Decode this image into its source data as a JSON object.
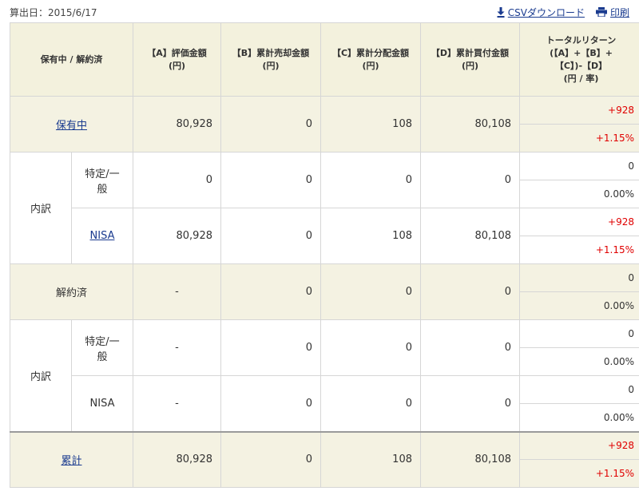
{
  "calc_date": "算出日：2015/6/17",
  "actions": {
    "csv": "CSVダウンロード",
    "print": "印刷"
  },
  "headers": {
    "status": "保有中 / 解約済",
    "a": "【A】評価金額\n(円)",
    "b": "【B】累計売却金額\n(円)",
    "c": "【C】累計分配金額\n(円)",
    "d": "【D】累計買付金額\n(円)",
    "ret": "トータルリターン\n(【A】+【B】+\n【C】)-【D】\n(円 / 率)"
  },
  "holding": {
    "label": "保有中",
    "a": "80,928",
    "b": "0",
    "c": "108",
    "d": "80,108",
    "ret_amount": "+928",
    "ret_rate": "+1.15%"
  },
  "holding_breakdown": {
    "label": "内訳",
    "rows": [
      {
        "label": "特定/一般",
        "a": "0",
        "b": "0",
        "c": "0",
        "d": "0",
        "ret_amount": "0",
        "ret_rate": "0.00%"
      },
      {
        "label": "NISA",
        "a": "80,928",
        "b": "0",
        "c": "108",
        "d": "80,108",
        "ret_amount": "+928",
        "ret_rate": "+1.15%"
      }
    ]
  },
  "cancelled": {
    "label": "解約済",
    "a": "-",
    "b": "0",
    "c": "0",
    "d": "0",
    "ret_amount": "0",
    "ret_rate": "0.00%"
  },
  "cancelled_breakdown": {
    "label": "内訳",
    "rows": [
      {
        "label": "特定/一般",
        "a": "-",
        "b": "0",
        "c": "0",
        "d": "0",
        "ret_amount": "0",
        "ret_rate": "0.00%"
      },
      {
        "label": "NISA",
        "a": "-",
        "b": "0",
        "c": "0",
        "d": "0",
        "ret_amount": "0",
        "ret_rate": "0.00%"
      }
    ]
  },
  "total": {
    "label": "累計",
    "a": "80,928",
    "b": "0",
    "c": "108",
    "d": "80,108",
    "ret_amount": "+928",
    "ret_rate": "+1.15%"
  },
  "colors": {
    "positive": "#e00000",
    "link": "#1a3b8f",
    "header_bg": "#f3f1dd",
    "row_bg": "#f4f2e2"
  }
}
